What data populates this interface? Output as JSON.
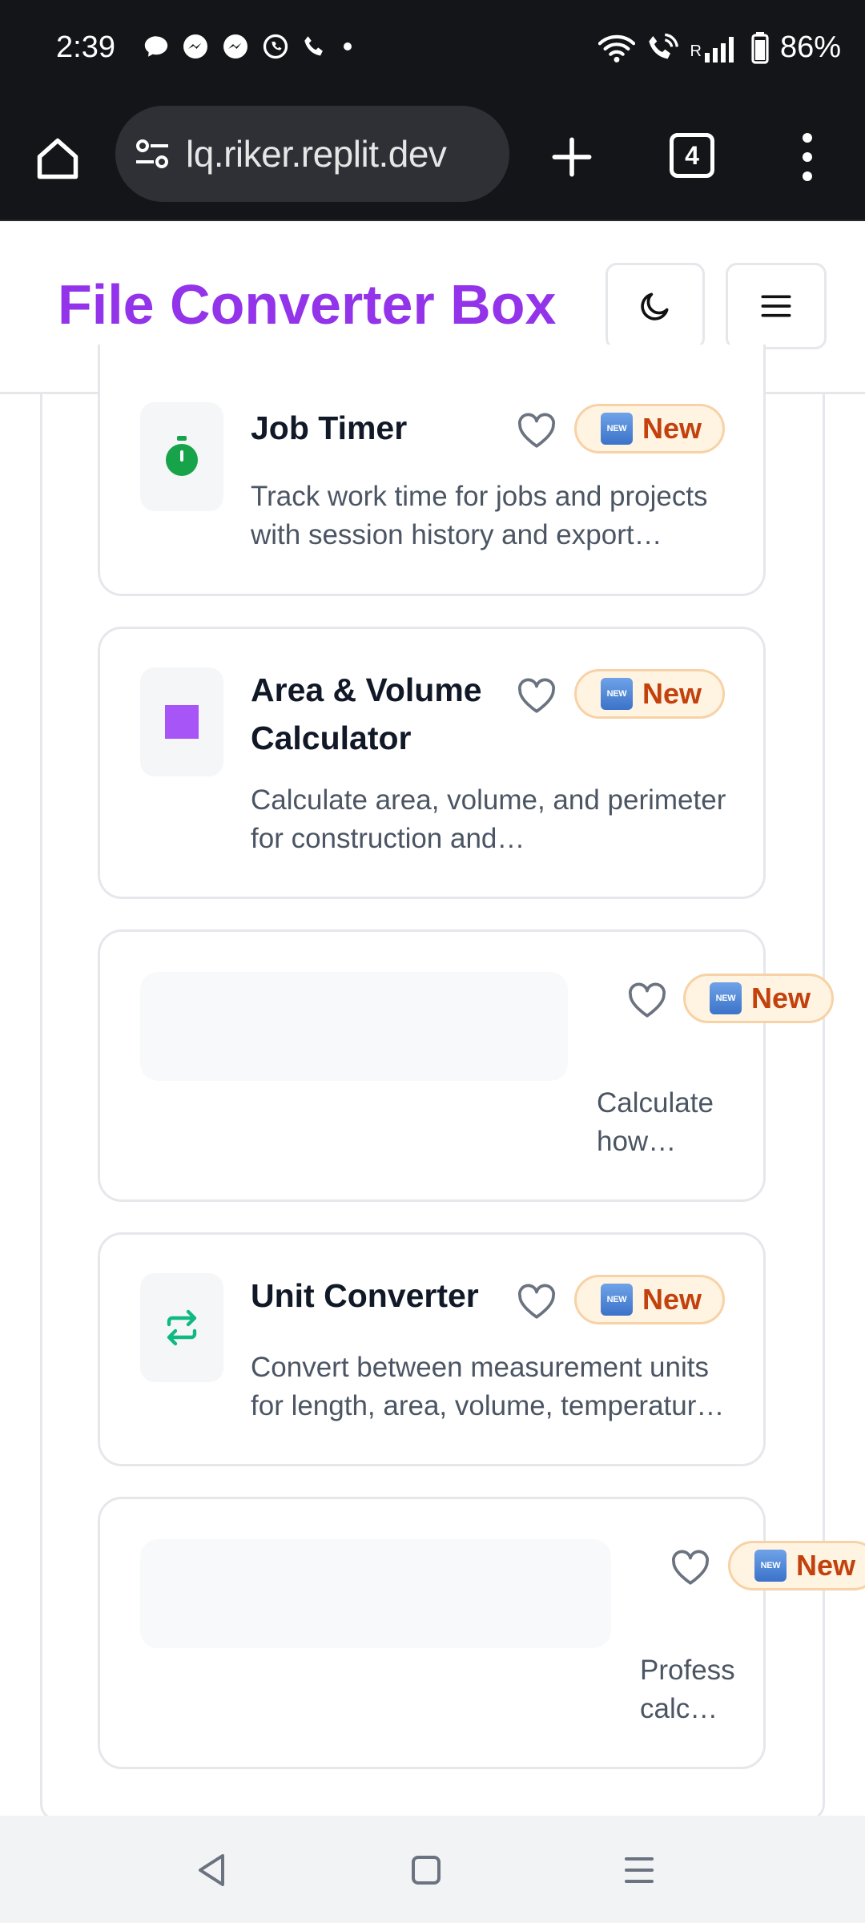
{
  "status_bar": {
    "time": "2:39",
    "battery": "86%",
    "signal_label": "R"
  },
  "browser": {
    "url": "lq.riker.replit.dev",
    "tab_count": "4"
  },
  "app": {
    "title": "File Converter Box",
    "title_color": "#9333ea"
  },
  "cards": [
    {
      "title": "Job Timer",
      "description": "Track work time for jobs and projects with session history and export…",
      "badge": "New",
      "badge_icon_text": "NEW",
      "icon": "stopwatch-icon",
      "icon_color": "#16a34a"
    },
    {
      "title": "Area & Volume Calculator",
      "description": "Calculate area, volume, and perimeter for construction and…",
      "badge": "New",
      "badge_icon_text": "NEW",
      "icon": "square-icon",
      "icon_color": "#a855f7"
    },
    {
      "title": "",
      "description": "Calculate how…",
      "badge": "New",
      "badge_icon_text": "NEW",
      "icon": "loading-placeholder"
    },
    {
      "title": "Unit Converter",
      "description": "Convert between measurement units for length, area, volume, temperatur…",
      "badge": "New",
      "badge_icon_text": "NEW",
      "icon": "repeat-arrows-icon",
      "icon_color": "#10b981"
    },
    {
      "title": "",
      "description": "Profess calc…",
      "badge": "New",
      "badge_icon_text": "NEW",
      "icon": "loading-placeholder"
    }
  ]
}
